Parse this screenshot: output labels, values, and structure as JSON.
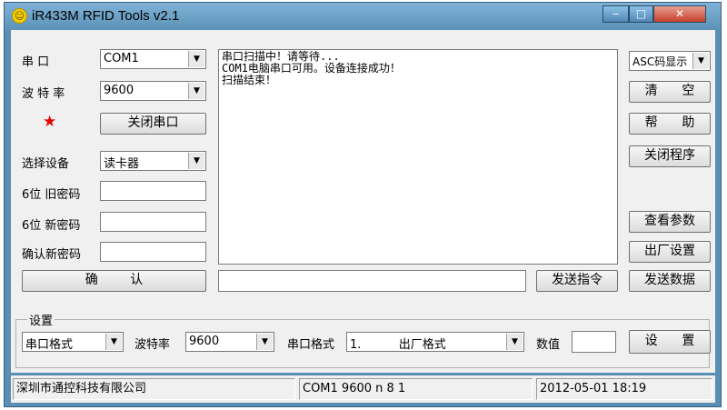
{
  "window": {
    "title": "iR433M RFID Tools v2.1",
    "controls": {
      "minimize": "‒",
      "maximize": "□",
      "close": "✕"
    }
  },
  "left_panel": {
    "serial_port_label": "串   口",
    "serial_port_value": "COM1",
    "baud_rate_label": "波 特 率",
    "baud_rate_value": "9600",
    "close_port_button": "关闭串口",
    "select_device_label": "选择设备",
    "select_device_value": "读卡器",
    "old_password_label": "6位  旧密码",
    "old_password_value": "",
    "new_password_label": "6位  新密码",
    "new_password_value": "",
    "confirm_password_label": "确认新密码",
    "confirm_password_value": "",
    "confirm_button": "确        认"
  },
  "log": {
    "lines": [
      "串口扫描中！请等待...",
      "COM1电脑串口可用。设备连接成功！",
      "扫描结束！"
    ]
  },
  "command": {
    "input_value": "",
    "send_command_button": "发送指令"
  },
  "right_panel": {
    "display_mode_value": "ASC码显示",
    "clear_button": "清      空",
    "help_button": "帮      助",
    "close_program_button": "关闭程序",
    "view_params_button": "查看参数",
    "factory_settings_button": "出厂设置",
    "send_data_button": "发送数据"
  },
  "settings": {
    "group_title": "设置",
    "format_value": "串口格式",
    "baud_label": "波特率",
    "baud_value": "9600",
    "port_format_label": "串口格式",
    "port_format_value": "1.          出厂格式",
    "number_label": "数值",
    "number_value": "",
    "set_button": "设      置"
  },
  "statusbar": {
    "company": "深圳市通控科技有限公司",
    "port_info": "COM1 9600 n 8 1",
    "datetime": "2012-05-01 18:19"
  },
  "colors": {
    "star": "#e00000",
    "frame": "#5a8fb4"
  },
  "icons": {
    "app": "smiley-icon",
    "star": "star-icon",
    "dropdown": "chevron-down-icon"
  }
}
